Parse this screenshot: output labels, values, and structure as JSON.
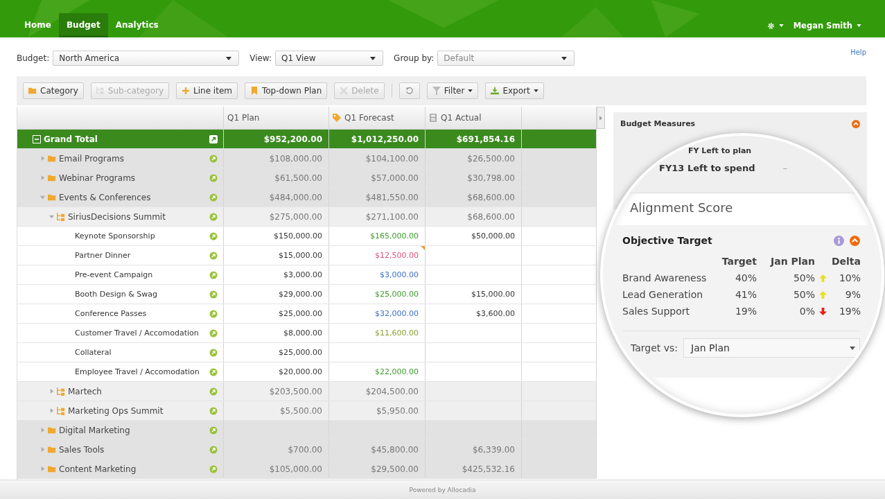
{
  "nav": {
    "tabs": [
      {
        "label": "Home",
        "selected": false
      },
      {
        "label": "Budget",
        "selected": true
      },
      {
        "label": "Analytics",
        "selected": false
      }
    ],
    "user": "Megan Smith"
  },
  "filters": {
    "budget_label": "Budget:",
    "budget": "North America",
    "view_label": "View:",
    "view": "Q1 View",
    "group_label": "Group by:",
    "group_placeholder": "Default",
    "help": "Help"
  },
  "toolbar": [
    {
      "kind": "category",
      "label": "Category",
      "disabled": false
    },
    {
      "kind": "subcategory",
      "label": "Sub-category",
      "disabled": true
    },
    {
      "kind": "lineitem",
      "label": "Line item",
      "disabled": false
    },
    {
      "kind": "topdown",
      "label": "Top-down Plan",
      "disabled": false
    },
    {
      "kind": "delete",
      "label": "Delete",
      "disabled": true
    },
    {
      "kind": "undo",
      "disabled": false
    },
    {
      "kind": "filter",
      "label": "Filter",
      "disabled": false
    },
    {
      "kind": "export",
      "label": "Export",
      "disabled": false
    }
  ],
  "table": {
    "columns": [
      "Q1 Plan",
      "Q1 Forecast",
      "Q1 Actual"
    ],
    "rows": [
      {
        "kind": "total",
        "name": "Grand Total",
        "expanded": true,
        "plan": "$952,200.00",
        "forecast": "$1,012,250.00",
        "actual": "$691,854.16",
        "children": [
          {
            "kind": "category",
            "name": "Email Programs",
            "expanded": false,
            "plan": "$108,000.00",
            "forecast": "$104,100.00",
            "actual": "$26,500.00"
          },
          {
            "kind": "category",
            "name": "Webinar Programs",
            "expanded": false,
            "plan": "$61,500.00",
            "forecast": "$57,000.00",
            "actual": "$30,798.00"
          },
          {
            "kind": "category",
            "name": "Events & Conferences",
            "expanded": true,
            "plan": "$484,000.00",
            "forecast": "$481,550.00",
            "actual": "$68,600.00",
            "children": [
              {
                "kind": "subcategory",
                "name": "SiriusDecisions Summit",
                "expanded": true,
                "plan": "$275,000.00",
                "forecast": "$271,100.00",
                "actual": "$68,600.00",
                "children": [
                  {
                    "kind": "item",
                    "name": "Keynote Sponsorship",
                    "plan": "$150,000.00",
                    "forecast": "$165,000.00",
                    "color": "#3a9a2a",
                    "actual": "$50,000.00"
                  },
                  {
                    "kind": "item",
                    "name": "Partner Dinner",
                    "plan": "$15,000.00",
                    "forecast": "$12,500.00",
                    "color": "#e0507a",
                    "flagged": true
                  },
                  {
                    "kind": "item",
                    "name": "Pre-event Campaign",
                    "plan": "$3,000.00",
                    "forecast": "$3,000.00",
                    "color": "#3a6ec8"
                  },
                  {
                    "kind": "item",
                    "name": "Booth Design & Swag",
                    "plan": "$29,000.00",
                    "forecast": "$25,000.00",
                    "color": "#3a9a2a",
                    "actual": "$15,000.00"
                  },
                  {
                    "kind": "item",
                    "name": "Conference Passes",
                    "plan": "$25,000.00",
                    "forecast": "$32,000.00",
                    "color": "#3a6ec8",
                    "actual": "$3,600.00"
                  },
                  {
                    "kind": "item",
                    "name": "Customer Travel / Accomodation",
                    "plan": "$8,000.00",
                    "forecast": "$11,600.00",
                    "color": "#8aa030"
                  },
                  {
                    "kind": "item",
                    "name": "Collateral",
                    "plan": "$25,000.00"
                  },
                  {
                    "kind": "item",
                    "name": "Employee Travel / Accomodation",
                    "plan": "$20,000.00",
                    "forecast": "$22,000.00",
                    "color": "#3a9a2a"
                  }
                ]
              },
              {
                "kind": "subcategory",
                "name": "Martech",
                "expanded": false,
                "plan": "$203,500.00",
                "forecast": "$204,500.00"
              },
              {
                "kind": "subcategory",
                "name": "Marketing Ops Summit",
                "expanded": false,
                "plan": "$5,500.00",
                "forecast": "$5,950.00"
              }
            ]
          },
          {
            "kind": "category",
            "name": "Digital Marketing",
            "expanded": false
          },
          {
            "kind": "category",
            "name": "Sales Tools",
            "expanded": false,
            "plan": "$700.00",
            "forecast": "$45,800.00",
            "actual": "$6,339.00"
          },
          {
            "kind": "category",
            "name": "Content Marketing",
            "expanded": false,
            "plan": "$105,000.00",
            "forecast": "$29,500.00",
            "actual": "$425,532.16"
          }
        ]
      }
    ]
  },
  "measures": {
    "title": "Budget Measures",
    "rows": [
      {
        "label": "FY Left to plan"
      },
      {
        "label": "FY13 Left to spend",
        "value": "–"
      }
    ]
  },
  "alignment": {
    "title": "Alignment Score",
    "card_title": "Objective Target",
    "columns": [
      "Target",
      "Jan Plan",
      "Delta"
    ],
    "rows": [
      {
        "name": "Brand Awareness",
        "target": "40%",
        "plan": "50%",
        "kind": "up",
        "delta": "10%"
      },
      {
        "name": "Lead Generation",
        "target": "41%",
        "plan": "50%",
        "kind": "up",
        "delta": "9%"
      },
      {
        "name": "Sales Support",
        "target": "19%",
        "plan": "0%",
        "kind": "down",
        "delta": "19%"
      }
    ],
    "target_label": "Target vs:",
    "target_value": "Jan Plan"
  },
  "footer": "Powered by Allocadia"
}
